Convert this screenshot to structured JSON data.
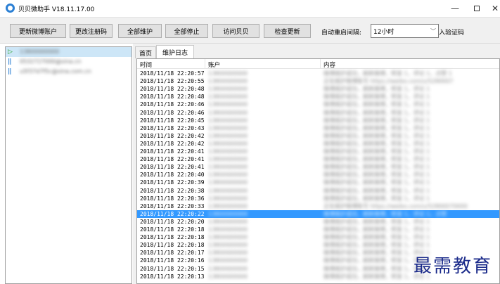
{
  "window": {
    "title": "贝贝微助手 V18.11.17.00",
    "min_glyph": "—",
    "close_glyph": "✕"
  },
  "toolbar": {
    "buttons": [
      "更新微博账户",
      "更改注册码",
      "全部维护",
      "全部停止",
      "访问贝贝",
      "检查更新"
    ],
    "interval_label": "自动重启间隔:",
    "interval_value": "12小时",
    "cert_label": "入验证码"
  },
  "accounts": [
    {
      "name": "13800000000",
      "state": "running",
      "icon": "play-icon",
      "glyph": "▷"
    },
    {
      "name": "0532727000@sina.cn",
      "state": "paused",
      "icon": "pause-icon",
      "glyph": "||"
    },
    {
      "name": "u5f37d7f5c@sina.com.cn",
      "state": "paused",
      "icon": "pause-icon",
      "glyph": "||"
    }
  ],
  "tabs": [
    "首页",
    "维护日志"
  ],
  "log": {
    "columns": [
      "时间",
      "账户",
      "内容"
    ],
    "rows": [
      {
        "time": "2018/11/18 22:20:57",
        "account": "13800000000",
        "content": "微博维护成功，刷新微博，转发 1，评论 1，点赞 1"
      },
      {
        "time": "2018/11/18 22:20:55",
        "account": "13800000000",
        "content": "正在维护微博账号 https://weibo.com/u/5280007"
      },
      {
        "time": "2018/11/18 22:20:48",
        "account": "13800000000",
        "content": "微博维护成功，刷新微博，转发 1，评论 1"
      },
      {
        "time": "2018/11/18 22:20:48",
        "account": "13800000000",
        "content": "微博维护成功，刷新微博，转发 1，评论 1"
      },
      {
        "time": "2018/11/18 22:20:46",
        "account": "13800000000",
        "content": "微博维护成功，刷新微博，转发 1，评论 1"
      },
      {
        "time": "2018/11/18 22:20:46",
        "account": "13800000000",
        "content": "微博维护成功，刷新微博，转发 1，评论 1"
      },
      {
        "time": "2018/11/18 22:20:45",
        "account": "13800000000",
        "content": "微博维护成功，刷新微博，转发 1，评论 1"
      },
      {
        "time": "2018/11/18 22:20:43",
        "account": "13800000000",
        "content": "微博维护成功，刷新微博，转发 1，评论 1"
      },
      {
        "time": "2018/11/18 22:20:42",
        "account": "13800000000",
        "content": "微博维护成功，刷新微博，转发 1，评论 1"
      },
      {
        "time": "2018/11/18 22:20:42",
        "account": "13800000000",
        "content": "微博维护成功，刷新微博，转发 1，评论 1"
      },
      {
        "time": "2018/11/18 22:20:41",
        "account": "13800000000",
        "content": "微博维护成功，刷新微博，转发 1，评论 1"
      },
      {
        "time": "2018/11/18 22:20:41",
        "account": "13800000000",
        "content": "微博维护成功，刷新微博，转发 1，评论 1"
      },
      {
        "time": "2018/11/18 22:20:41",
        "account": "13800000000",
        "content": "微博维护成功，刷新微博，转发 1，评论 1"
      },
      {
        "time": "2018/11/18 22:20:40",
        "account": "13800000000",
        "content": "微博维护成功，刷新微博，转发 1，评论 1"
      },
      {
        "time": "2018/11/18 22:20:39",
        "account": "13800000000",
        "content": "微博维护成功，刷新微博，转发 1，评论 1"
      },
      {
        "time": "2018/11/18 22:20:38",
        "account": "13800000000",
        "content": "微博维护成功，刷新微博，转发 1，评论 1"
      },
      {
        "time": "2018/11/18 22:20:36",
        "account": "13800000000",
        "content": "微博维护成功，刷新微博，转发 1，评论 1"
      },
      {
        "time": "2018/11/18 22:20:33",
        "account": "13800000000",
        "content": "正在维护微博账号 https://weibo.com/u/52800070000"
      },
      {
        "time": "2018/11/18 22:20:22",
        "account": "13800000000",
        "content": "微博维护成功，刷新微博，转发 1，评论 1，点赞"
      },
      {
        "time": "2018/11/18 22:20:20",
        "account": "13800000000",
        "content": "微博维护成功，刷新微博，转发 1，评论 1"
      },
      {
        "time": "2018/11/18 22:20:18",
        "account": "13800000000",
        "content": "微博维护成功，刷新微博，转发 1，评论 1"
      },
      {
        "time": "2018/11/18 22:20:18",
        "account": "13800000000",
        "content": "微博维护成功，刷新微博，转发 1，评论 1"
      },
      {
        "time": "2018/11/18 22:20:18",
        "account": "13800000000",
        "content": "微博维护成功，刷新微博，转发 1，评论 1"
      },
      {
        "time": "2018/11/18 22:20:17",
        "account": "13800000000",
        "content": "微博维护成功，刷新微博，转发 1，评论 1"
      },
      {
        "time": "2018/11/18 22:20:16",
        "account": "13800000000",
        "content": "微博维护成功，刷新微博，转发 1，评论 1"
      },
      {
        "time": "2018/11/18 22:20:15",
        "account": "13800000000",
        "content": "微博维护成功，刷新微博，转发 1，评论 1"
      },
      {
        "time": "2018/11/18 22:20:13",
        "account": "13800000000",
        "content": "微博维护成功，刷新微博，转发 1，评论 1"
      }
    ],
    "selected_row_index": 18
  },
  "watermark": "最需教育",
  "colors": {
    "selection": "#3399ff",
    "account_selected": "#cde6f7",
    "play_icon": "#2aa52a",
    "pause_icon": "#2a7fd4",
    "watermark": "#1a2a8a"
  }
}
